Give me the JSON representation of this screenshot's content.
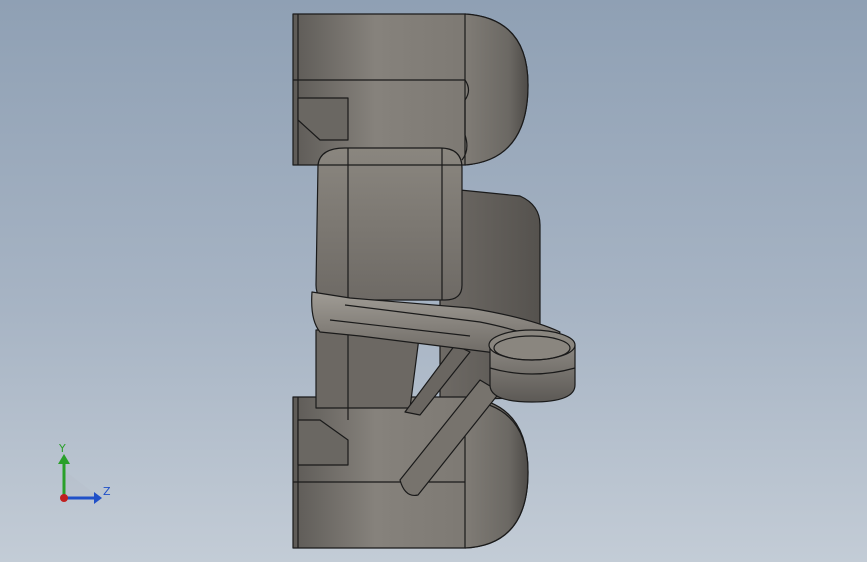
{
  "view": {
    "background_top": "#8fa0b4",
    "background_bottom": "#c3ccd6",
    "model_color": "#807c76",
    "edge_color": "#1a1a1a"
  },
  "triad": {
    "y_label": "Y",
    "z_label": "Z",
    "y_color": "#2aa02a",
    "z_color": "#2050c8",
    "x_color": "#c02020"
  }
}
